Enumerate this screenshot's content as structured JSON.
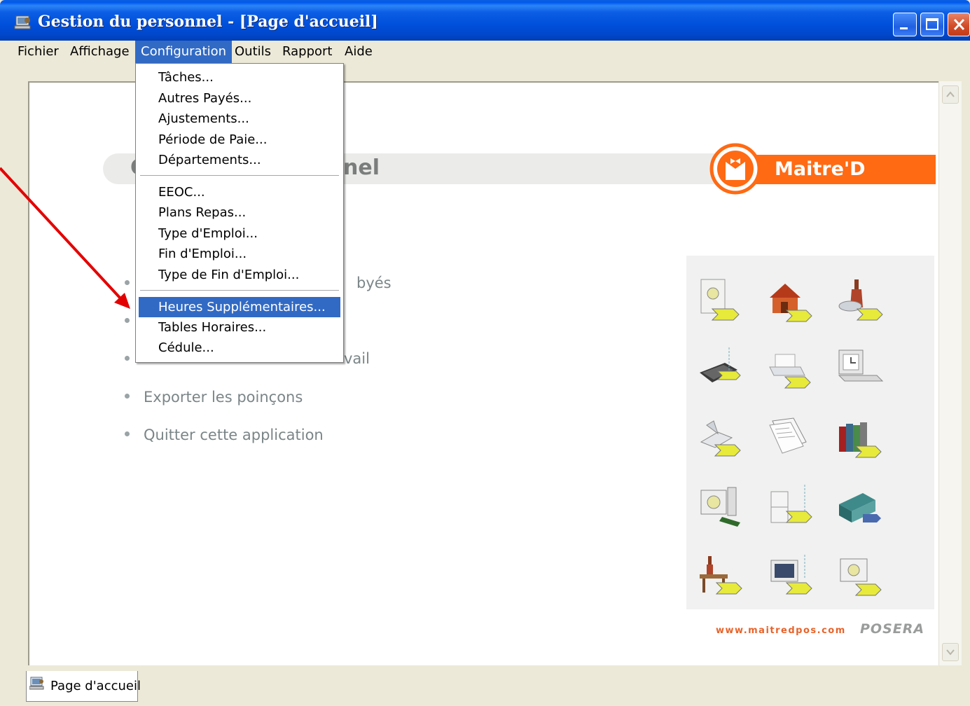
{
  "window": {
    "title": "Gestion du personnel - [Page d'accueil]"
  },
  "menubar": {
    "items": [
      "Fichier",
      "Affichage",
      "Configuration",
      "Outils",
      "Rapport",
      "Aide"
    ],
    "active": "Configuration"
  },
  "dropdown": {
    "groups": [
      [
        "Tâches...",
        "Autres Payés...",
        "Ajustements...",
        "Période de Paie...",
        "Départements..."
      ],
      [
        "EEOC...",
        "Plans Repas...",
        "Type d'Emploi...",
        "Fin d'Emploi...",
        "Type de Fin d'Emploi..."
      ],
      [
        "Heures Supplémentaires...",
        "Tables Horaires...",
        "Cédule..."
      ]
    ],
    "highlighted": "Heures Supplémentaires..."
  },
  "main": {
    "header_title_start": "C",
    "header_title_end": "nel",
    "brand": "Maitre'D",
    "partial_texts": [
      "byés",
      "vail"
    ],
    "links": [
      "Exporter les poinçons",
      "Quitter cette application"
    ],
    "footer_url": "www.maitredpos.com",
    "footer_brand": "POSERA"
  },
  "tabs": [
    {
      "label": "Page d'accueil",
      "icon": "computer-user-icon"
    }
  ],
  "icons": [
    "safe-icon",
    "house-icon",
    "wine-bottle-icon",
    "laptop-icon",
    "printer-icon",
    "desktop-clock-icon",
    "scanner-icon",
    "documents-icon",
    "binders-icon",
    "computer-safe-icon",
    "filing-cabinet-icon",
    "server-icon",
    "table-bottle-icon",
    "monitor-chart-icon",
    "monitor-safe-icon"
  ],
  "colors": {
    "titlebar": "#0054e3",
    "menu_highlight": "#316ac5",
    "brand_orange": "#ff6a13",
    "annotation_arrow": "#e30000"
  }
}
